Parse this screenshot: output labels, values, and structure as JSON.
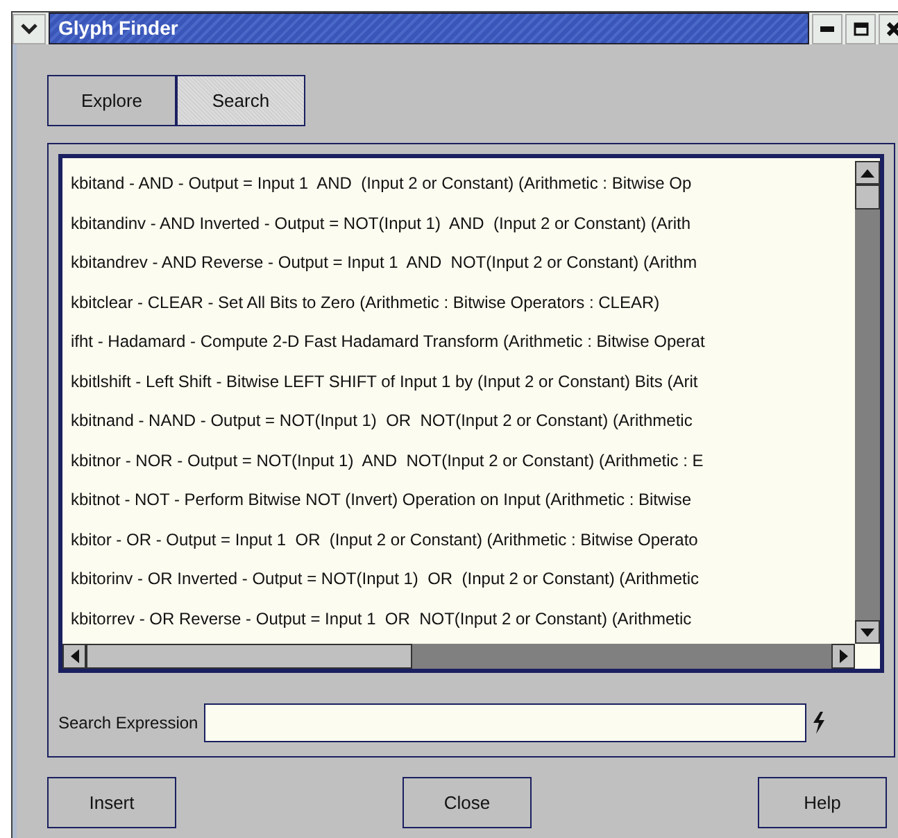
{
  "window": {
    "title": "Glyph Finder"
  },
  "tabs": [
    {
      "label": "Explore",
      "selected": false
    },
    {
      "label": "Search",
      "selected": true
    }
  ],
  "results": [
    "kbitand - AND - Output = Input 1  AND  (Input 2 or Constant) (Arithmetic : Bitwise Op",
    "kbitandinv - AND Inverted - Output = NOT(Input 1)  AND  (Input 2 or Constant) (Arith",
    "kbitandrev - AND Reverse - Output = Input 1  AND  NOT(Input 2 or Constant) (Arithm",
    "kbitclear - CLEAR - Set All Bits to Zero (Arithmetic : Bitwise Operators : CLEAR)",
    "ifht - Hadamard - Compute 2-D Fast Hadamard Transform (Arithmetic : Bitwise Operat",
    "kbitlshift - Left Shift - Bitwise LEFT SHIFT of Input 1 by (Input 2 or Constant) Bits (Arit",
    "kbitnand - NAND - Output = NOT(Input 1)  OR  NOT(Input 2 or Constant) (Arithmetic",
    "kbitnor - NOR - Output = NOT(Input 1)  AND  NOT(Input 2 or Constant) (Arithmetic : E",
    "kbitnot - NOT - Perform Bitwise NOT (Invert) Operation on Input (Arithmetic : Bitwise",
    "kbitor - OR - Output = Input 1  OR  (Input 2 or Constant) (Arithmetic : Bitwise Operato",
    "kbitorinv - OR Inverted - Output = NOT(Input 1)  OR  (Input 2 or Constant) (Arithmetic",
    "kbitorrev - OR Reverse - Output = Input 1  OR  NOT(Input 2 or Constant) (Arithmetic"
  ],
  "search": {
    "label": "Search Expression"
  },
  "buttons": [
    "Insert",
    "Close",
    "Help"
  ]
}
